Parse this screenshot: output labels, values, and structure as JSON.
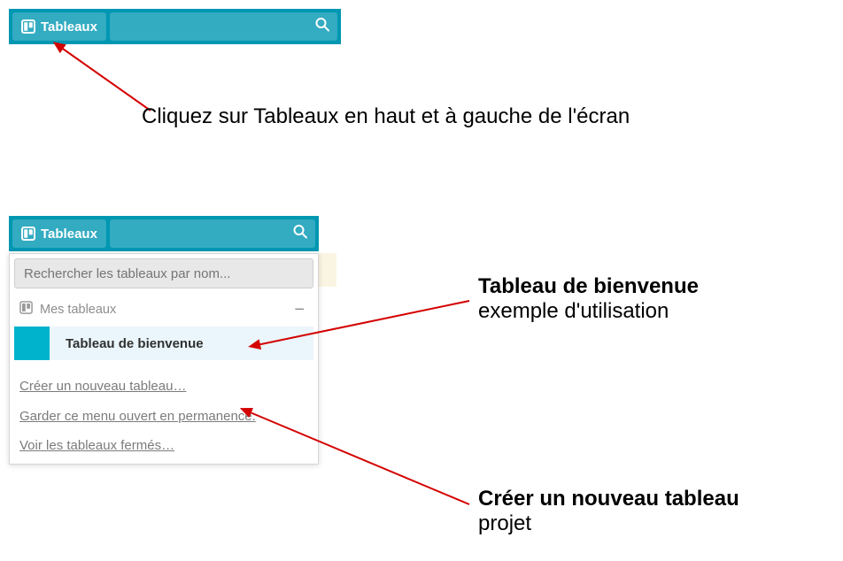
{
  "header": {
    "boards_label": "Tableaux"
  },
  "annotations": {
    "top": "Cliquez sur Tableaux en haut et à gauche de l'écran",
    "welcome_title": "Tableau de bienvenue",
    "welcome_sub": "exemple d'utilisation",
    "create_title": "Créer un nouveau tableau",
    "create_sub": "projet"
  },
  "menu": {
    "search_placeholder": "Rechercher les tableaux par nom...",
    "section_label": "Mes tableaux",
    "board_title": "Tableau de bienvenue",
    "link_create": "Créer un nouveau tableau…",
    "link_keep_open": "Garder ce menu ouvert en permanence.",
    "link_closed": "Voir les tableaux fermés…"
  }
}
